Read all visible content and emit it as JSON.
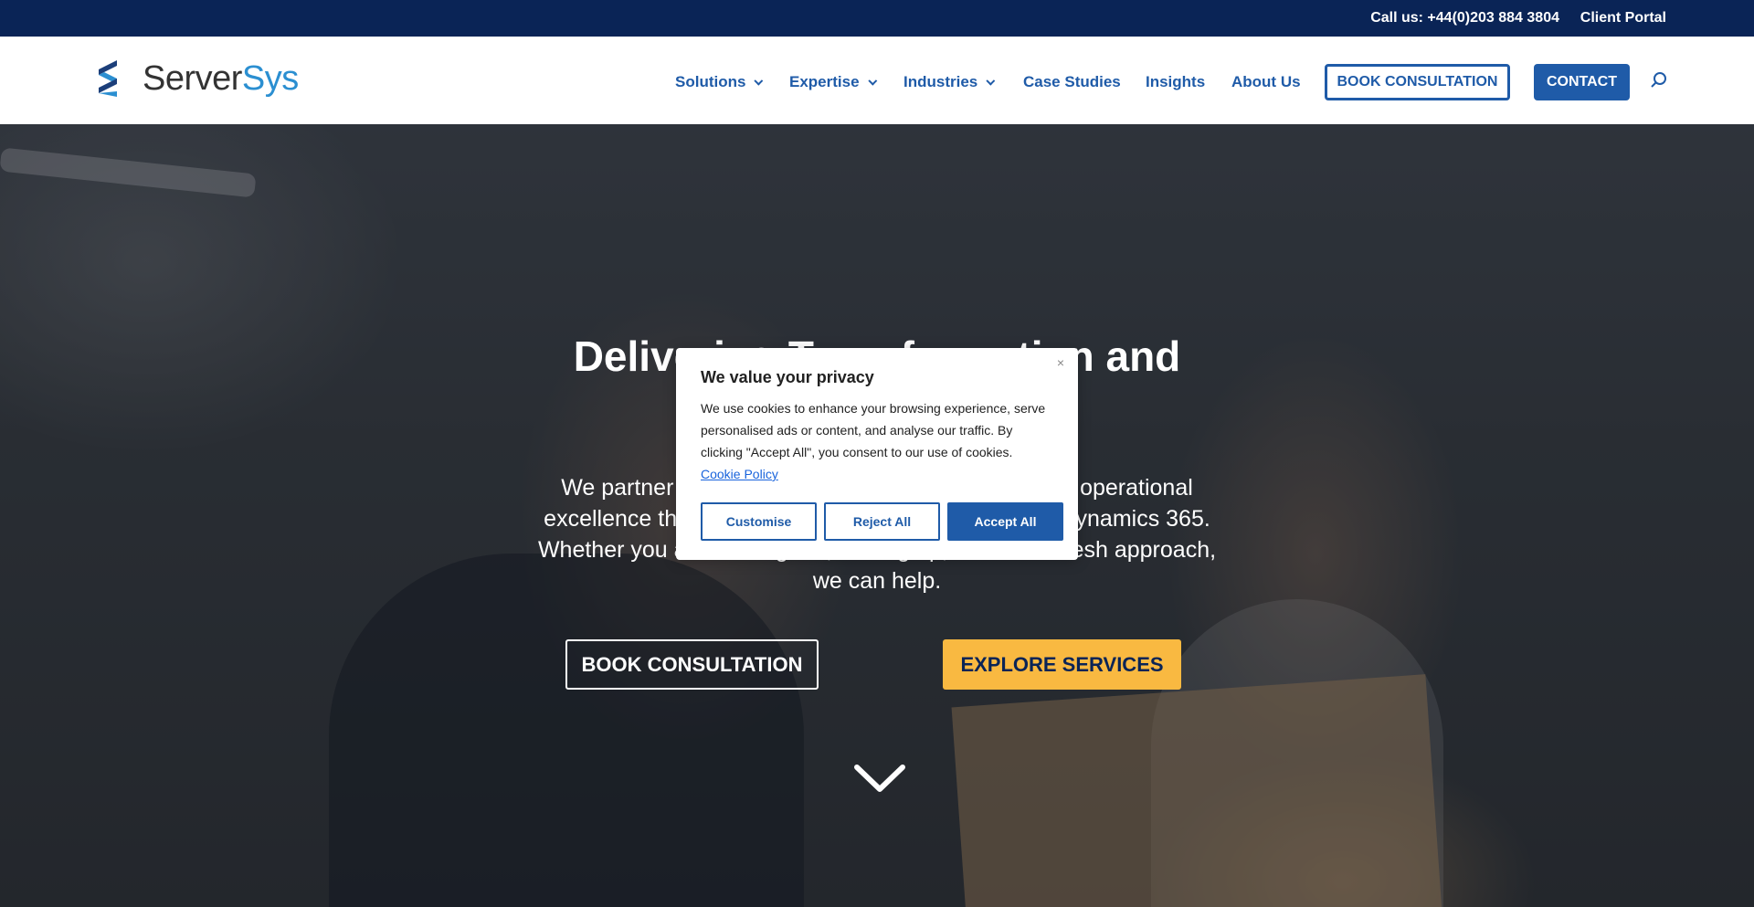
{
  "topbar": {
    "phone": "Call us: +44(0)203 884 3804",
    "portal": "Client Portal"
  },
  "logo": {
    "name_part1": "Server",
    "name_part2": "Sys"
  },
  "nav": {
    "items": [
      {
        "label": "Solutions",
        "dropdown": true
      },
      {
        "label": "Expertise",
        "dropdown": true
      },
      {
        "label": "Industries",
        "dropdown": true
      },
      {
        "label": "Case Studies",
        "dropdown": false
      },
      {
        "label": "Insights",
        "dropdown": false
      },
      {
        "label": "About Us",
        "dropdown": false
      }
    ],
    "book_label": "BOOK CONSULTATION",
    "contact_label": "CONTACT",
    "search_icon": "search-icon"
  },
  "hero": {
    "title": "Delivering Transformation and Operational Partner",
    "subtitle": "We partner with organisations to drive service, and operational excellence through leading technologies, including Dynamics 365. Whether you are starting out, scaling up, or need a fresh approach, we can help.",
    "book_label": "BOOK CONSULTATION",
    "explore_label": "EXPLORE SERVICES",
    "scroll_icon": "chevron-down-icon"
  },
  "cookie": {
    "title": "We value your privacy",
    "text": "We use cookies to enhance your browsing experience, serve personalised ads or content, and analyse our traffic. By clicking \"Accept All\", you consent to our use of cookies.",
    "link": "Cookie Policy",
    "close": "×",
    "customise": "Customise",
    "reject": "Reject All",
    "accept": "Accept All"
  },
  "colors": {
    "topbar": "#0a2456",
    "brand_blue": "#1f5ba8",
    "accent_yellow": "#f9b941",
    "logo_blue": "#2b8fd1"
  }
}
